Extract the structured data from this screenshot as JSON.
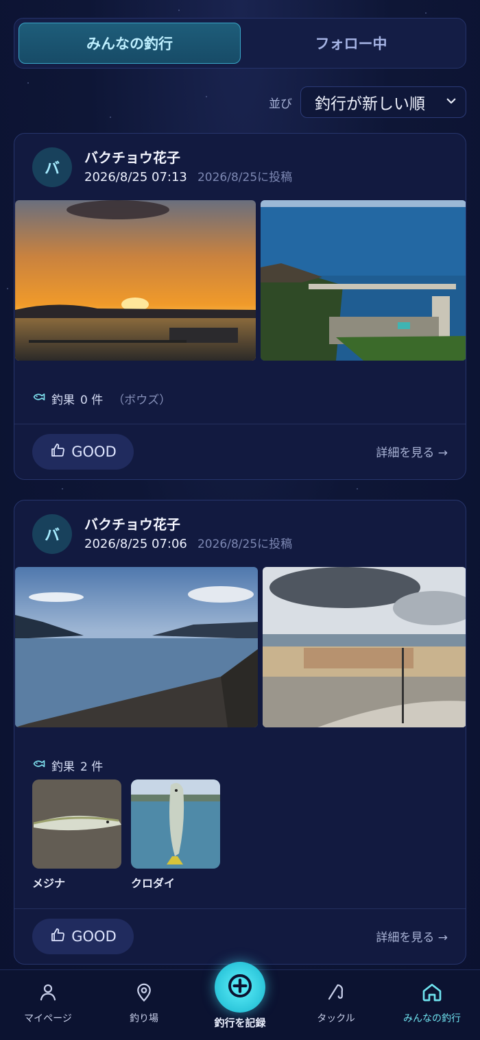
{
  "tabs": [
    {
      "label": "みんなの釣行",
      "active": true
    },
    {
      "label": "フォロー中",
      "active": false
    }
  ],
  "sort": {
    "label": "並び",
    "selected": "釣行が新しい順"
  },
  "posts": [
    {
      "author_initial": "バ",
      "author_name": "バクチョウ花子",
      "trip_time": "2026/8/25 07:13",
      "posted": "2026/8/25に投稿",
      "catch_label": "釣果",
      "catch_count": "0 件",
      "catch_note": "（ボウズ）",
      "good_label": "GOOD",
      "detail_label": "詳細を見る →"
    },
    {
      "author_initial": "バ",
      "author_name": "バクチョウ花子",
      "trip_time": "2026/8/25 07:06",
      "posted": "2026/8/25に投稿",
      "catch_label": "釣果",
      "catch_count": "2 件",
      "fish": [
        {
          "name": "メジナ"
        },
        {
          "name": "クロダイ"
        }
      ],
      "good_label": "GOOD",
      "detail_label": "詳細を見る →"
    }
  ],
  "bottom_nav": [
    {
      "label": "マイページ",
      "icon": "person-icon"
    },
    {
      "label": "釣り場",
      "icon": "map-pin-icon"
    },
    {
      "label": "釣行を記録",
      "icon": "plus-circle-icon"
    },
    {
      "label": "タックル",
      "icon": "fishing-rod-icon"
    },
    {
      "label": "みんなの釣行",
      "icon": "home-icon",
      "active": true
    }
  ],
  "colors": {
    "accent": "#4fe0f0",
    "background": "#0e1636",
    "card": "#121a40"
  }
}
